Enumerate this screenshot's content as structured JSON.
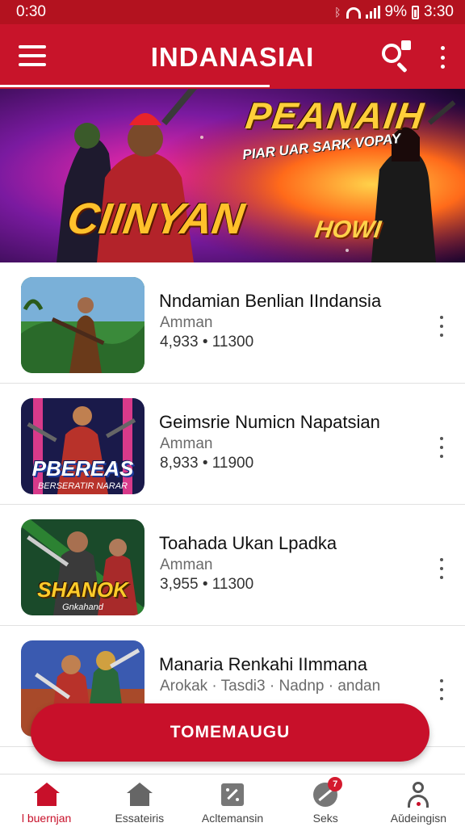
{
  "status_bar": {
    "time_left": "0:30",
    "battery_percent": "9%",
    "time_right": "3:30"
  },
  "app_bar": {
    "title": "INDANASIAI",
    "menu_icon": "hamburger-menu-icon",
    "search_icon": "search-icon",
    "more_icon": "more-vertical-icon"
  },
  "banner": {
    "title_main": "PEANAIH",
    "title_sub": "PIAR UAR SARK VOPAY",
    "left_word": "CIINYAN",
    "right_word": "HOWI"
  },
  "games": [
    {
      "name": "Nndamian Benlian IIndansia",
      "publisher": "Amman",
      "meta": "4,933 • 11300",
      "thumb_label": "",
      "thumb_sub": ""
    },
    {
      "name": "Geimsrie Numicn Napatsian",
      "publisher": "Amman",
      "meta": "8,933 • 11900",
      "thumb_label": "PBEREAS",
      "thumb_sub": "BERSERATIR NARAR"
    },
    {
      "name": "Toahada Ukan Lpadka",
      "publisher": "Amman",
      "meta": "3,955 • 11300",
      "thumb_label": "SHANOK",
      "thumb_sub": "Gnkahand"
    },
    {
      "name": "Manaria Renkahi IImmana",
      "publisher": "Arokak · Tasdi3 · Nadnp · andan",
      "meta": "",
      "thumb_label": "",
      "thumb_sub": ""
    }
  ],
  "fab": {
    "label": "TOMEMAUGU"
  },
  "bottom_nav": [
    {
      "label": "Ɩ buernjan",
      "icon": "home-icon",
      "active": true
    },
    {
      "label": "Essateiris",
      "icon": "store-icon",
      "active": false
    },
    {
      "label": "Acltemansin",
      "icon": "percent-icon",
      "active": false
    },
    {
      "label": "Seks",
      "icon": "leaf-icon",
      "badge": "7",
      "active": false
    },
    {
      "label": "Aǔdeingisn",
      "icon": "profile-icon",
      "active": false
    }
  ],
  "colors": {
    "primary": "#c8142a",
    "status_bar": "#b3121f",
    "text_primary": "#111111",
    "text_secondary": "#6b6b6b"
  }
}
